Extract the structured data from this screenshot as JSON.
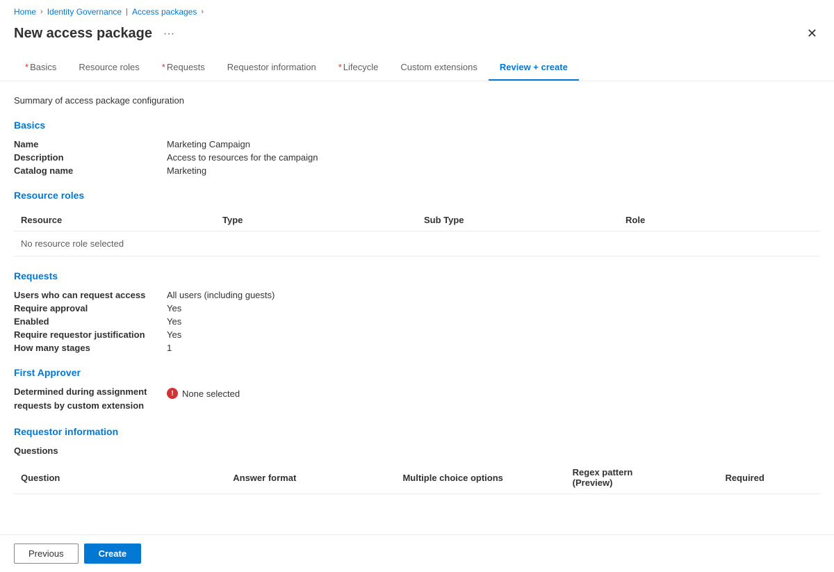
{
  "breadcrumb": {
    "home": "Home",
    "identity_governance": "Identity Governance",
    "access_packages": "Access packages"
  },
  "page": {
    "title": "New access package",
    "ellipsis_label": "···",
    "close_label": "✕",
    "summary_text": "Summary of access package configuration"
  },
  "tabs": [
    {
      "id": "basics",
      "label": "Basics",
      "required": true,
      "active": false
    },
    {
      "id": "resource-roles",
      "label": "Resource roles",
      "required": false,
      "active": false
    },
    {
      "id": "requests",
      "label": "Requests",
      "required": true,
      "active": false
    },
    {
      "id": "requestor-information",
      "label": "Requestor information",
      "required": false,
      "active": false
    },
    {
      "id": "lifecycle",
      "label": "Lifecycle",
      "required": true,
      "active": false
    },
    {
      "id": "custom-extensions",
      "label": "Custom extensions",
      "required": false,
      "active": false
    },
    {
      "id": "review-create",
      "label": "Review + create",
      "required": false,
      "active": true
    }
  ],
  "sections": {
    "basics": {
      "title": "Basics",
      "fields": [
        {
          "label": "Name",
          "value": "Marketing Campaign"
        },
        {
          "label": "Description",
          "value": "Access to resources for the campaign"
        },
        {
          "label": "Catalog name",
          "value": "Marketing"
        }
      ]
    },
    "resource_roles": {
      "title": "Resource roles",
      "table_headers": [
        "Resource",
        "Type",
        "Sub Type",
        "Role"
      ],
      "no_data_message": "No resource role selected"
    },
    "requests": {
      "title": "Requests",
      "fields": [
        {
          "label": "Users who can request access",
          "value": "All users (including guests)"
        },
        {
          "label": "Require approval",
          "value": "Yes"
        },
        {
          "label": "Enabled",
          "value": "Yes"
        },
        {
          "label": "Require requestor justification",
          "value": "Yes"
        },
        {
          "label": "How many stages",
          "value": "1"
        }
      ]
    },
    "first_approver": {
      "title": "First Approver",
      "field_label": "Determined during assignment\nrequests by custom extension",
      "warning_value": "None selected"
    },
    "requestor_information": {
      "title": "Requestor information",
      "questions_label": "Questions",
      "table_headers": [
        "Question",
        "Answer format",
        "Multiple choice options",
        "Regex pattern\n(Preview)",
        "Required"
      ]
    }
  },
  "footer": {
    "previous_label": "Previous",
    "create_label": "Create"
  },
  "colors": {
    "accent": "#0078d4",
    "danger": "#d13438",
    "text_primary": "#323130",
    "text_secondary": "#605e5c",
    "border": "#edebe9"
  }
}
